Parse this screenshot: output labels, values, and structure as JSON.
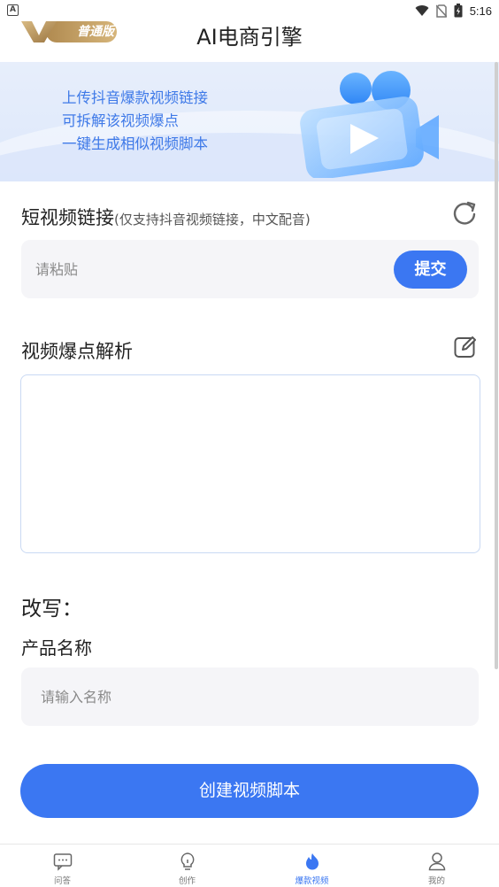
{
  "status_bar": {
    "time": "5:16",
    "left_badge": "A"
  },
  "header": {
    "vip_label": "普通版",
    "title": "AI电商引擎"
  },
  "banner": {
    "lines": [
      "上传抖音爆款视频链接",
      "可拆解该视频爆点",
      "一键生成相似视频脚本"
    ]
  },
  "link_section": {
    "title": "短视频链接",
    "hint": "(仅支持抖音视频链接，中文配音)",
    "placeholder": "请粘贴",
    "submit_label": "提交"
  },
  "analysis_section": {
    "title": "视频爆点解析",
    "value": ""
  },
  "rewrite_section": {
    "title": "改写：",
    "product_label": "产品名称",
    "name_placeholder": "请输入名称",
    "create_label": "创建视频脚本"
  },
  "bottom_nav": {
    "items": [
      {
        "label": "问答",
        "icon": "chat-icon"
      },
      {
        "label": "创作",
        "icon": "bulb-icon"
      },
      {
        "label": "爆款视频",
        "icon": "hot-video-icon",
        "active": true
      },
      {
        "label": "我的",
        "icon": "user-icon"
      }
    ]
  },
  "colors": {
    "accent": "#3b77f2",
    "banner_text": "#3f7ae8",
    "vip_gold": "#c7a367"
  }
}
